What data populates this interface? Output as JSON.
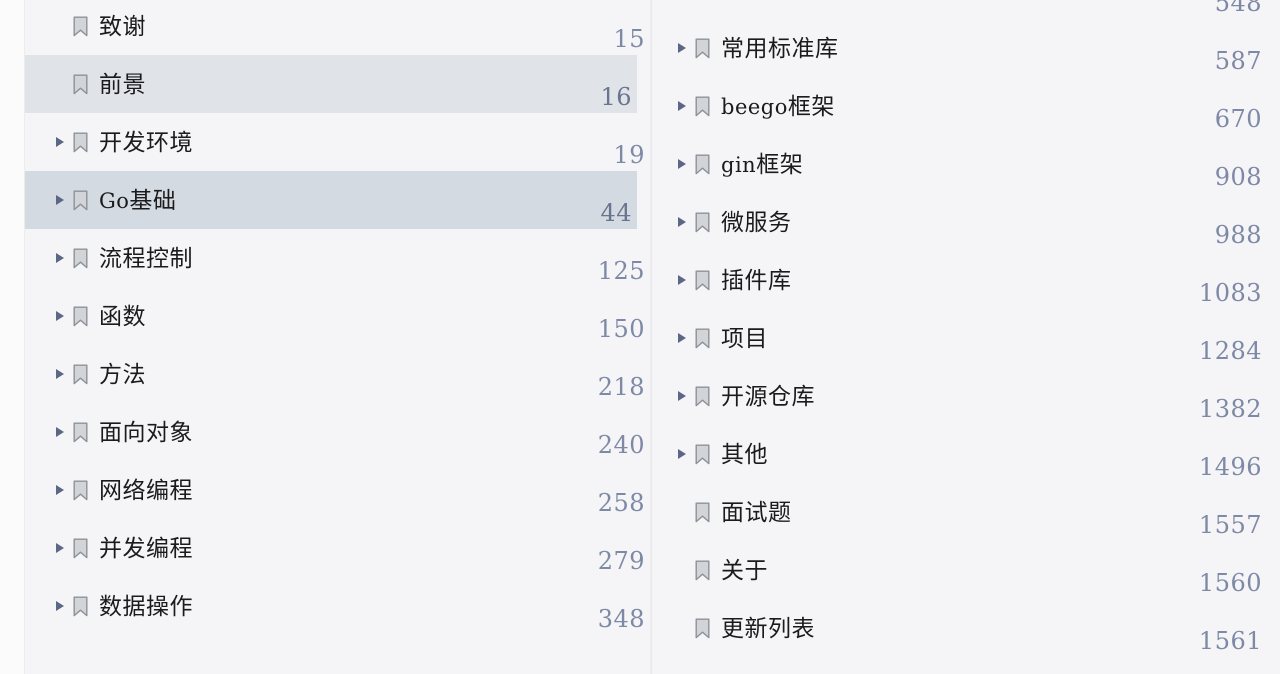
{
  "document": {
    "kind": "table-of-contents",
    "background_color": "#f5f5f7",
    "highlight_color_1": "#e0e3e8",
    "highlight_color_2": "#d4dae1",
    "page_number_color": "#7e89a6",
    "label_color": "#1b1b1e"
  },
  "icons": {
    "bookmark": "bookmark-icon",
    "caret": "caret-right-icon"
  },
  "columns": [
    {
      "name": "left-column",
      "items": [
        {
          "label": "致谢",
          "page": "15",
          "has_children": false,
          "highlight": "none",
          "mono_lead": ""
        },
        {
          "label": "前景",
          "page": "16",
          "has_children": false,
          "highlight": "hl-1",
          "mono_lead": ""
        },
        {
          "label": "开发环境",
          "page": "19",
          "has_children": true,
          "highlight": "none",
          "mono_lead": ""
        },
        {
          "label": "Go基础",
          "page": "44",
          "has_children": true,
          "highlight": "hl-2",
          "mono_lead": "Go",
          "cjk": "基础"
        },
        {
          "label": "流程控制",
          "page": "125",
          "has_children": true,
          "highlight": "none",
          "mono_lead": ""
        },
        {
          "label": "函数",
          "page": "150",
          "has_children": true,
          "highlight": "none",
          "mono_lead": ""
        },
        {
          "label": "方法",
          "page": "218",
          "has_children": true,
          "highlight": "none",
          "mono_lead": ""
        },
        {
          "label": "面向对象",
          "page": "240",
          "has_children": true,
          "highlight": "none",
          "mono_lead": ""
        },
        {
          "label": "网络编程",
          "page": "258",
          "has_children": true,
          "highlight": "none",
          "mono_lead": ""
        },
        {
          "label": "并发编程",
          "page": "279",
          "has_children": true,
          "highlight": "none",
          "mono_lead": ""
        },
        {
          "label": "数据操作",
          "page": "348",
          "has_children": true,
          "highlight": "none",
          "mono_lead": ""
        }
      ]
    },
    {
      "name": "right-column",
      "clipped_top_page": "548",
      "items": [
        {
          "label": "常用标准库",
          "page": "587",
          "has_children": true,
          "highlight": "none",
          "mono_lead": ""
        },
        {
          "label": "beego框架",
          "page": "670",
          "has_children": true,
          "highlight": "none",
          "mono_lead": "beego",
          "cjk": "框架"
        },
        {
          "label": "gin框架",
          "page": "908",
          "has_children": true,
          "highlight": "none",
          "mono_lead": "gin",
          "cjk": "框架"
        },
        {
          "label": "微服务",
          "page": "988",
          "has_children": true,
          "highlight": "none",
          "mono_lead": ""
        },
        {
          "label": "插件库",
          "page": "1083",
          "has_children": true,
          "highlight": "none",
          "mono_lead": ""
        },
        {
          "label": "项目",
          "page": "1284",
          "has_children": true,
          "highlight": "none",
          "mono_lead": ""
        },
        {
          "label": "开源仓库",
          "page": "1382",
          "has_children": true,
          "highlight": "none",
          "mono_lead": ""
        },
        {
          "label": "其他",
          "page": "1496",
          "has_children": true,
          "highlight": "none",
          "mono_lead": ""
        },
        {
          "label": "面试题",
          "page": "1557",
          "has_children": false,
          "highlight": "none",
          "mono_lead": ""
        },
        {
          "label": "关于",
          "page": "1560",
          "has_children": false,
          "highlight": "none",
          "mono_lead": ""
        },
        {
          "label": "更新列表",
          "page": "1561",
          "has_children": false,
          "highlight": "none",
          "mono_lead": ""
        }
      ]
    }
  ]
}
